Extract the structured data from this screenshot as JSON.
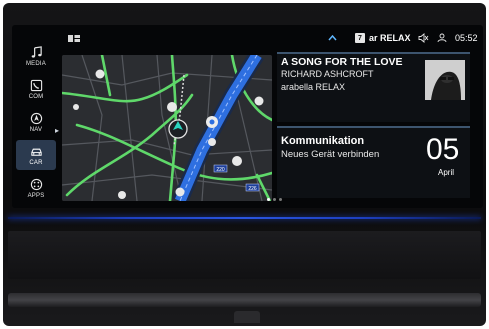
{
  "sidebar": {
    "items": [
      {
        "label": "MEDIA",
        "icon": "music-note-icon"
      },
      {
        "label": "COM",
        "icon": "phone-icon"
      },
      {
        "label": "NAV",
        "icon": "navigation-icon"
      },
      {
        "label": "CAR",
        "icon": "car-icon"
      },
      {
        "label": "APPS",
        "icon": "apps-icon"
      }
    ],
    "active": "CAR"
  },
  "status_bar": {
    "channel_badge": "7",
    "station": "ar RELAX",
    "time": "05:52",
    "icons": [
      "chevron-up-icon",
      "mute-icon",
      "user-icon"
    ]
  },
  "map": {
    "road_labels": [
      "220",
      "226"
    ]
  },
  "media": {
    "title": "A SONG FOR THE LOVE",
    "artist": "RICHARD ASHCROFT",
    "station": "arabella RELAX"
  },
  "communication": {
    "title": "Kommunikation",
    "action": "Neues Gerät verbinden",
    "day": "05",
    "month": "April"
  },
  "colors": {
    "accent": "#3d556f",
    "route_blue": "#2e6fe0",
    "road_green": "#5fd86a",
    "ambient_blue": "#2a55e0"
  }
}
